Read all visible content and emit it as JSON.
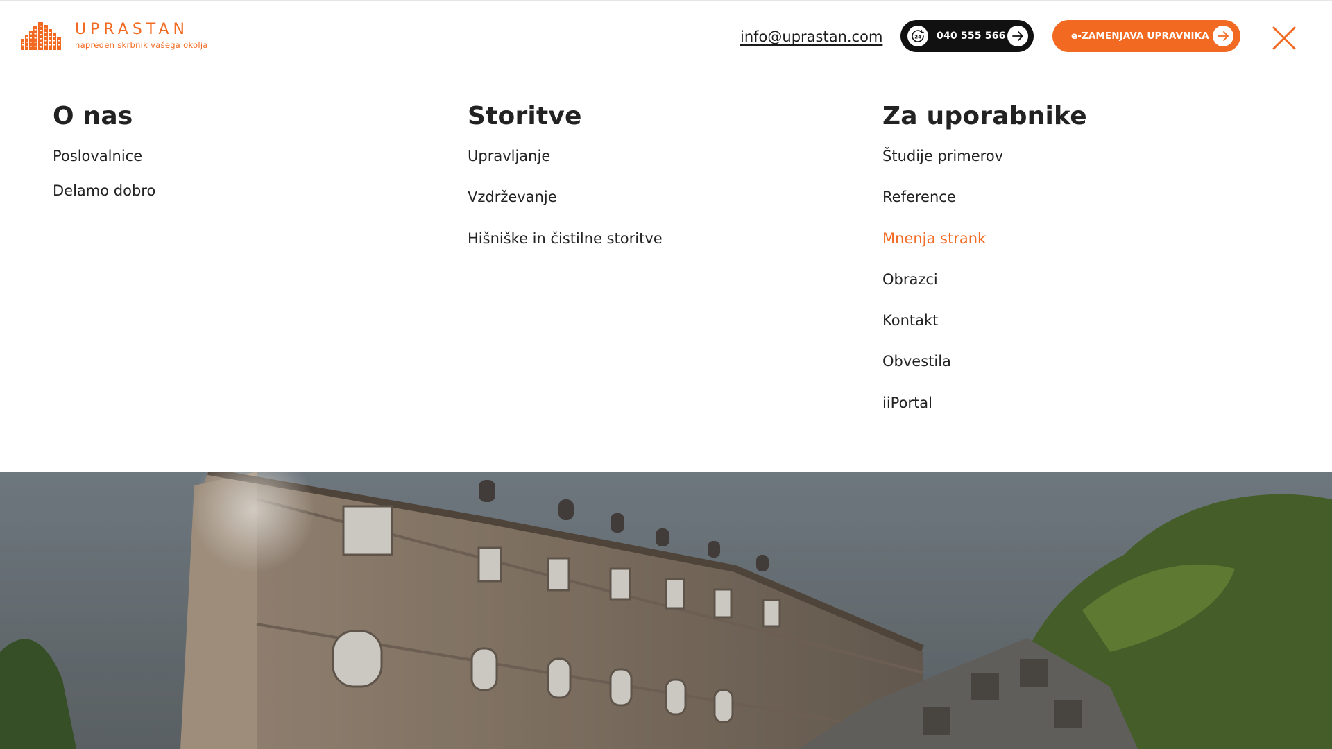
{
  "brand": {
    "name": "UPRASTAN",
    "tagline": "napreden skrbnik vašega okolja",
    "accent_color": "#f26a21"
  },
  "header": {
    "email": "info@uprastan.com",
    "phone_label": "040 555 566",
    "phone_icon": "24-hour-phone-icon",
    "cta_label": "e-ZAMENJAVA UPRAVNIKA",
    "close_icon": "close-icon"
  },
  "menu": {
    "columns": [
      {
        "title": "O nas",
        "items": [
          {
            "label": "Poslovalnice"
          },
          {
            "label": "Delamo dobro"
          }
        ]
      },
      {
        "title": "Storitve",
        "items": [
          {
            "label": "Upravljanje"
          },
          {
            "label": "Vzdrževanje"
          },
          {
            "label": "Hišniške in čistilne storitve"
          }
        ]
      },
      {
        "title": "Za uporabnike",
        "items": [
          {
            "label": "Študije primerov"
          },
          {
            "label": "Reference"
          },
          {
            "label": "Mnenja strank",
            "active": true
          },
          {
            "label": "Obrazci"
          },
          {
            "label": "Kontakt"
          },
          {
            "label": "Obvestila"
          },
          {
            "label": "iiPortal"
          }
        ]
      }
    ]
  },
  "hero": {
    "image": "historic-building-photo"
  }
}
